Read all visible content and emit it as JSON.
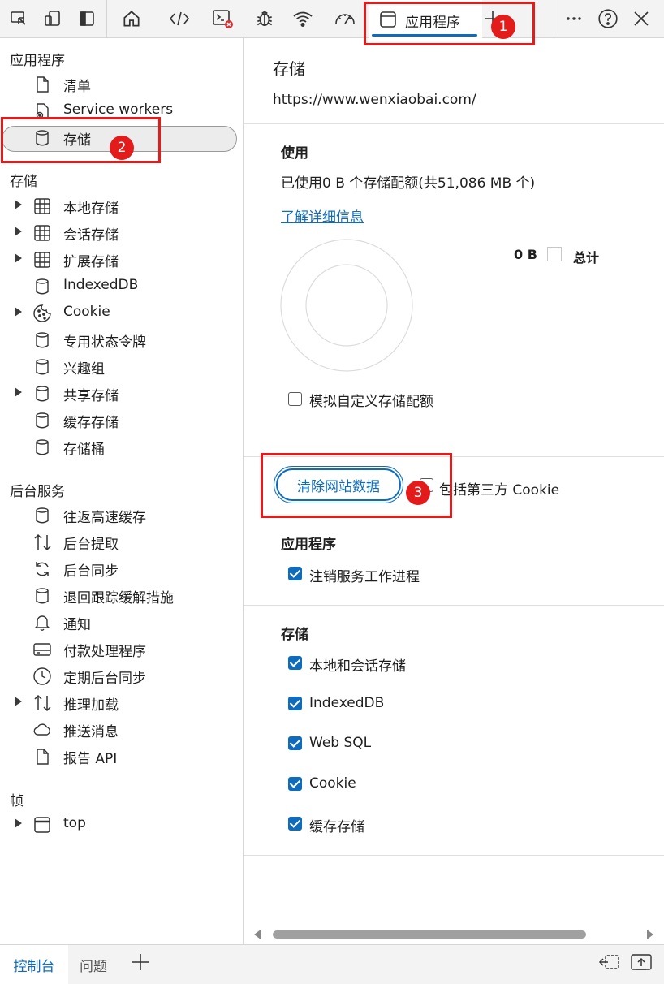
{
  "toolbar": {
    "active_tab_label": "应用程序",
    "icons": [
      "inspect-icon",
      "device-emulation-icon",
      "dock-icon",
      "home-icon",
      "elements-icon",
      "console-icon",
      "sources-icon",
      "network-icon",
      "performance-icon",
      "application-icon",
      "add-tab-icon",
      "more-icon",
      "help-icon",
      "close-icon"
    ]
  },
  "sidebar": {
    "sections": [
      {
        "title": "应用程序",
        "items": [
          {
            "label": "清单",
            "icon": "document-icon",
            "expandable": false
          },
          {
            "label": "Service workers",
            "icon": "gear-icon",
            "expandable": false
          },
          {
            "label": "存储",
            "icon": "database-icon",
            "expandable": false,
            "selected": true
          }
        ]
      },
      {
        "title": "存储",
        "items": [
          {
            "label": "本地存储",
            "icon": "grid-icon",
            "expandable": true
          },
          {
            "label": "会话存储",
            "icon": "grid-icon",
            "expandable": true
          },
          {
            "label": "扩展存储",
            "icon": "grid-icon",
            "expandable": true
          },
          {
            "label": "IndexedDB",
            "icon": "database-icon",
            "expandable": false
          },
          {
            "label": "Cookie",
            "icon": "cookie-icon",
            "expandable": true
          },
          {
            "label": "专用状态令牌",
            "icon": "database-icon",
            "expandable": false
          },
          {
            "label": "兴趣组",
            "icon": "database-icon",
            "expandable": false
          },
          {
            "label": "共享存储",
            "icon": "database-icon",
            "expandable": true
          },
          {
            "label": "缓存存储",
            "icon": "database-icon",
            "expandable": false
          },
          {
            "label": "存储桶",
            "icon": "database-icon",
            "expandable": false
          }
        ]
      },
      {
        "title": "后台服务",
        "items": [
          {
            "label": "往返高速缓存",
            "icon": "database-icon",
            "expandable": false
          },
          {
            "label": "后台提取",
            "icon": "up-down-arrows-icon",
            "expandable": false
          },
          {
            "label": "后台同步",
            "icon": "sync-icon",
            "expandable": false
          },
          {
            "label": "退回跟踪缓解措施",
            "icon": "database-icon",
            "expandable": false
          },
          {
            "label": "通知",
            "icon": "bell-icon",
            "expandable": false
          },
          {
            "label": "付款处理程序",
            "icon": "card-icon",
            "expandable": false
          },
          {
            "label": "定期后台同步",
            "icon": "clock-icon",
            "expandable": false
          },
          {
            "label": "推理加载",
            "icon": "up-down-arrows-icon",
            "expandable": true
          },
          {
            "label": "推送消息",
            "icon": "cloud-icon",
            "expandable": false
          },
          {
            "label": "报告 API",
            "icon": "document-icon",
            "expandable": false
          }
        ]
      },
      {
        "title": "帧",
        "items": [
          {
            "label": "top",
            "icon": "frame-icon",
            "expandable": true
          }
        ]
      }
    ]
  },
  "main": {
    "title": "存储",
    "url": "https://www.wenxiaobai.com/",
    "usage": {
      "heading": "使用",
      "summary": "已使用0 B 个存储配额(共51,086 MB 个)",
      "learn_more": "了解详细信息",
      "legend_value": "0 B",
      "legend_label": "总计",
      "simulate_quota_label": "模拟自定义存储配额",
      "simulate_quota_checked": false
    },
    "clear": {
      "button_label": "清除网站数据",
      "third_party_label": "包括第三方 Cookie",
      "third_party_checked": false
    },
    "application": {
      "heading": "应用程序",
      "unregister_label": "注销服务工作进程",
      "unregister_checked": true
    },
    "storage": {
      "heading": "存储",
      "options": [
        {
          "label": "本地和会话存储",
          "checked": true
        },
        {
          "label": "IndexedDB",
          "checked": true
        },
        {
          "label": "Web SQL",
          "checked": true
        },
        {
          "label": "Cookie",
          "checked": true
        },
        {
          "label": "缓存存储",
          "checked": true
        }
      ]
    }
  },
  "annotations": [
    "1",
    "2",
    "3"
  ],
  "bottom": {
    "tabs": [
      {
        "label": "控制台",
        "active": true
      },
      {
        "label": "问题",
        "active": false
      }
    ]
  },
  "colors": {
    "accent": "#0f6cbd",
    "annotation_red": "#e31b1b"
  }
}
